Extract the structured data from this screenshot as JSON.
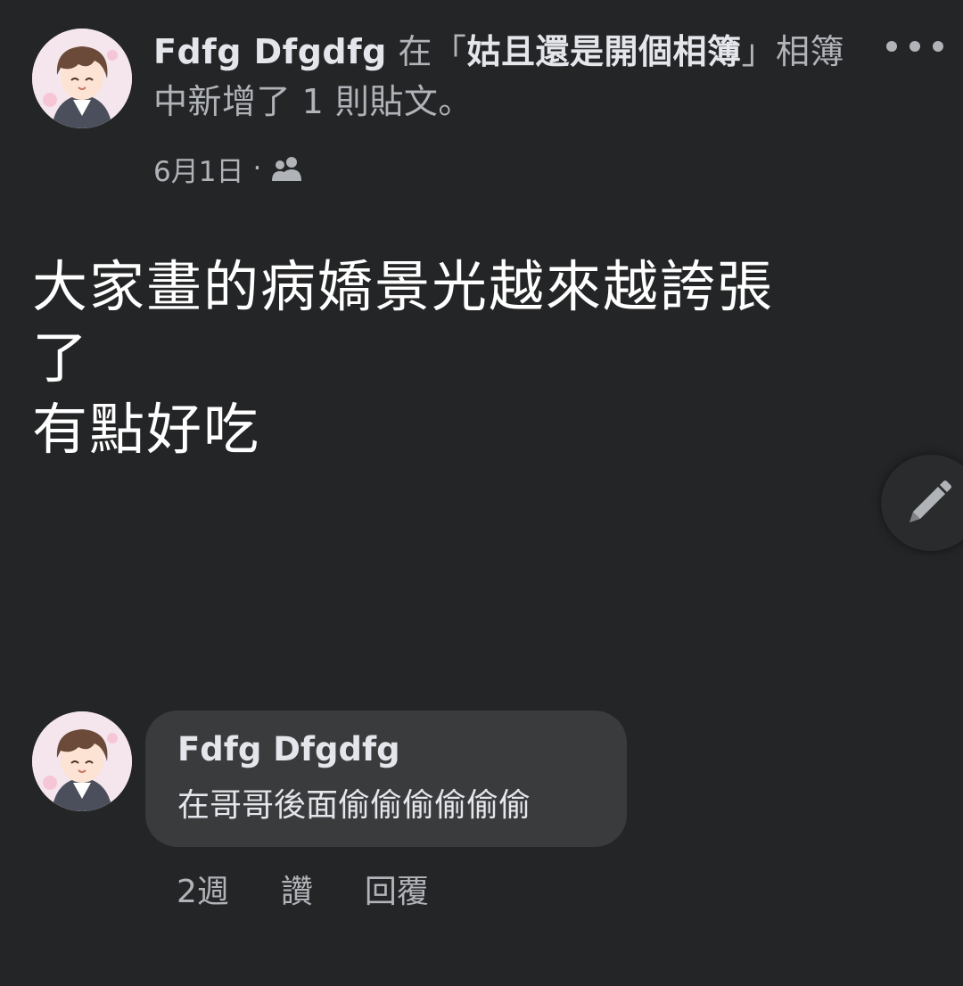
{
  "post": {
    "author": "Fdfg Dfgdfg",
    "header_in": " 在「",
    "album_name": "姑且還是開個相簿",
    "header_suffix": "」相簿中新增了 1 則貼文。",
    "date": "6月1日",
    "dot": "·",
    "audience_icon": "friends-icon",
    "body_lines": [
      "大家畫的病嬌景光越來越誇張",
      "了",
      "有點好吃"
    ]
  },
  "comment": {
    "author": "Fdfg Dfgdfg",
    "text": "在哥哥後面偷偷偷偷偷偷",
    "time": "2週",
    "like_label": "讚",
    "reply_label": "回覆"
  },
  "colors": {
    "background": "#242526",
    "bubble": "#3a3b3c",
    "primary_text": "#e4e6eb",
    "secondary_text": "#b0b3b8"
  }
}
